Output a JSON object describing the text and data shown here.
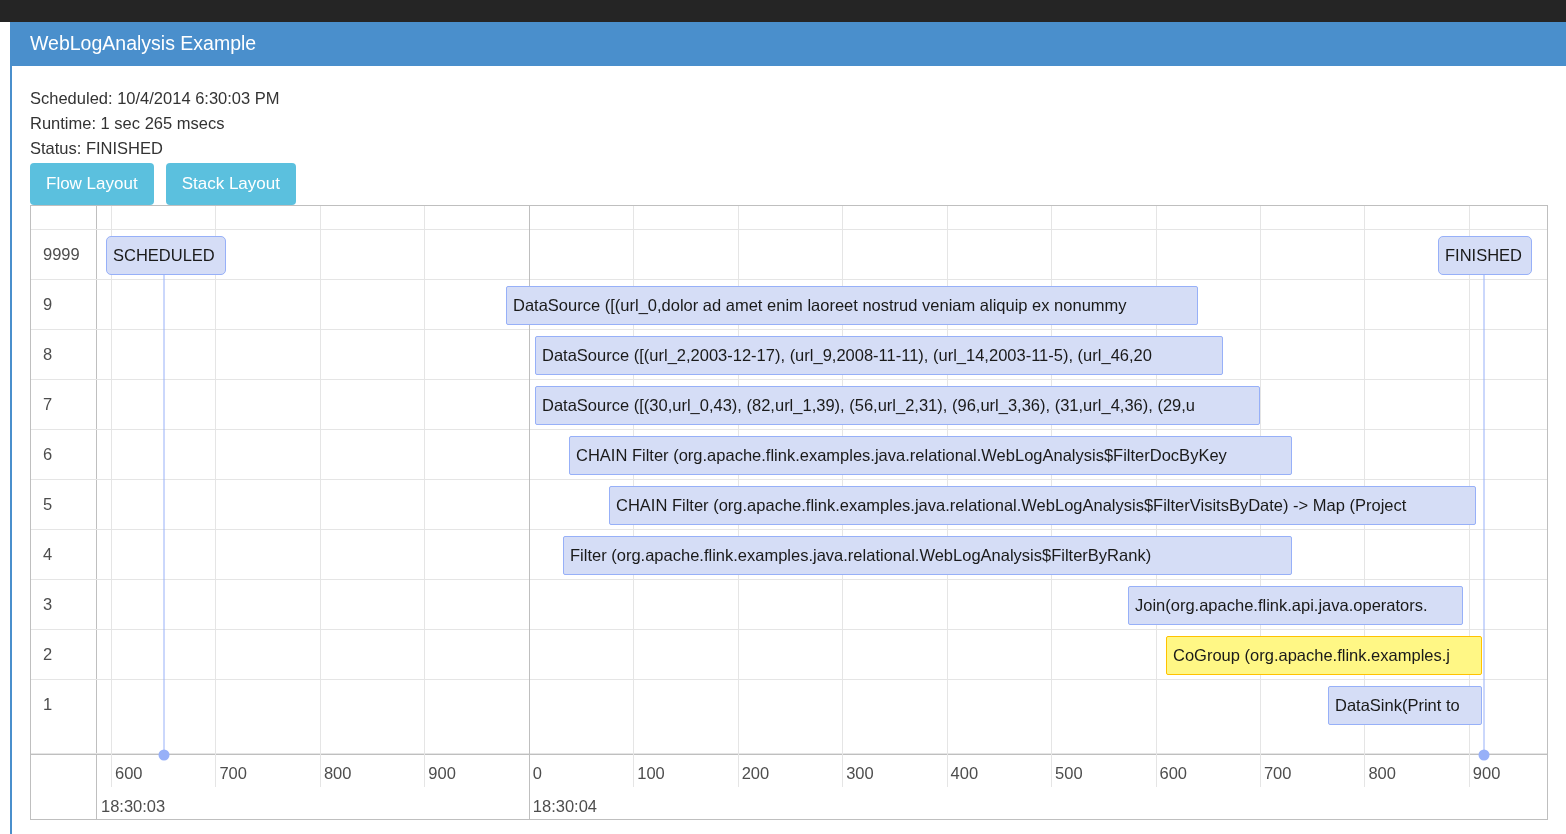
{
  "header": {
    "title": "WebLogAnalysis Example"
  },
  "info": [
    "Scheduled: 10/4/2014 6:30:03 PM",
    "Runtime: 1 sec 265 msecs",
    "Status: FINISHED"
  ],
  "buttons": [
    "Flow Layout",
    "Stack Layout"
  ],
  "timeline": {
    "groups": [
      {
        "label": "9999",
        "items": [
          {
            "kind": "marker",
            "text": "SCHEDULED",
            "selected": false
          },
          {
            "kind": "marker",
            "text": "FINISHED",
            "selected": false
          }
        ]
      },
      {
        "label": "9",
        "items": [
          {
            "kind": "range",
            "text": "DataSource ([(url_0,dolor ad amet enim laoreet nostrud veniam aliquip ex nonummy",
            "selected": false
          }
        ]
      },
      {
        "label": "8",
        "items": [
          {
            "kind": "range",
            "text": "DataSource ([(url_2,2003-12-17), (url_9,2008-11-11), (url_14,2003-11-5), (url_46,20",
            "selected": false
          }
        ]
      },
      {
        "label": "7",
        "items": [
          {
            "kind": "range",
            "text": "DataSource ([(30,url_0,43), (82,url_1,39), (56,url_2,31), (96,url_3,36), (31,url_4,36), (29,u",
            "selected": false
          }
        ]
      },
      {
        "label": "6",
        "items": [
          {
            "kind": "range",
            "text": "CHAIN Filter (org.apache.flink.examples.java.relational.WebLogAnalysis$FilterDocByKey",
            "selected": false
          }
        ]
      },
      {
        "label": "5",
        "items": [
          {
            "kind": "range",
            "text": "CHAIN Filter (org.apache.flink.examples.java.relational.WebLogAnalysis$FilterVisitsByDate) -> Map (Project",
            "selected": false
          }
        ]
      },
      {
        "label": "4",
        "items": [
          {
            "kind": "range",
            "text": "Filter (org.apache.flink.examples.java.relational.WebLogAnalysis$FilterByRank)",
            "selected": false
          }
        ]
      },
      {
        "label": "3",
        "items": [
          {
            "kind": "range",
            "text": "Join(org.apache.flink.api.java.operators.",
            "selected": false
          }
        ]
      },
      {
        "label": "2",
        "items": [
          {
            "kind": "range",
            "text": "CoGroup (org.apache.flink.examples.j",
            "selected": true
          }
        ]
      },
      {
        "label": "1",
        "items": [
          {
            "kind": "range",
            "text": "DataSink(Print to",
            "selected": false
          }
        ]
      }
    ],
    "axis": {
      "minor": [
        "600",
        "700",
        "800",
        "900",
        "0",
        "100",
        "200",
        "300",
        "400",
        "500",
        "600",
        "700",
        "800",
        "900"
      ],
      "major": [
        "18:30:03",
        "18:30:04"
      ]
    }
  }
}
